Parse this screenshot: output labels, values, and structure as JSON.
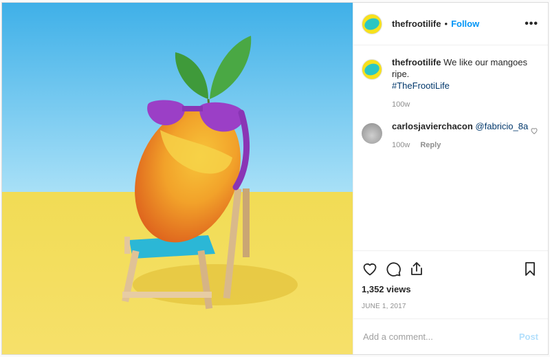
{
  "post": {
    "username": "thefrootilife",
    "follow_label": "Follow",
    "dot": "•",
    "more_label": "•••"
  },
  "comments": [
    {
      "username": "thefrootilife",
      "text": "We like our mangoes ripe.",
      "hashtag": "#TheFrootiLife",
      "time": "100w"
    },
    {
      "username": "carlosjavierchacon",
      "mention": "@fabricio_8a",
      "time": "100w",
      "reply_label": "Reply"
    }
  ],
  "stats": {
    "views": "1,352 views",
    "date": "JUNE 1, 2017"
  },
  "composer": {
    "placeholder": "Add a comment...",
    "post_label": "Post"
  },
  "colors": {
    "accent": "#0095f6",
    "link": "#00376b",
    "sky": "#4fb6ea",
    "floor": "#f4d73f"
  },
  "icons": [
    "heart-icon",
    "comment-icon",
    "share-icon",
    "bookmark-icon",
    "more-icon"
  ]
}
